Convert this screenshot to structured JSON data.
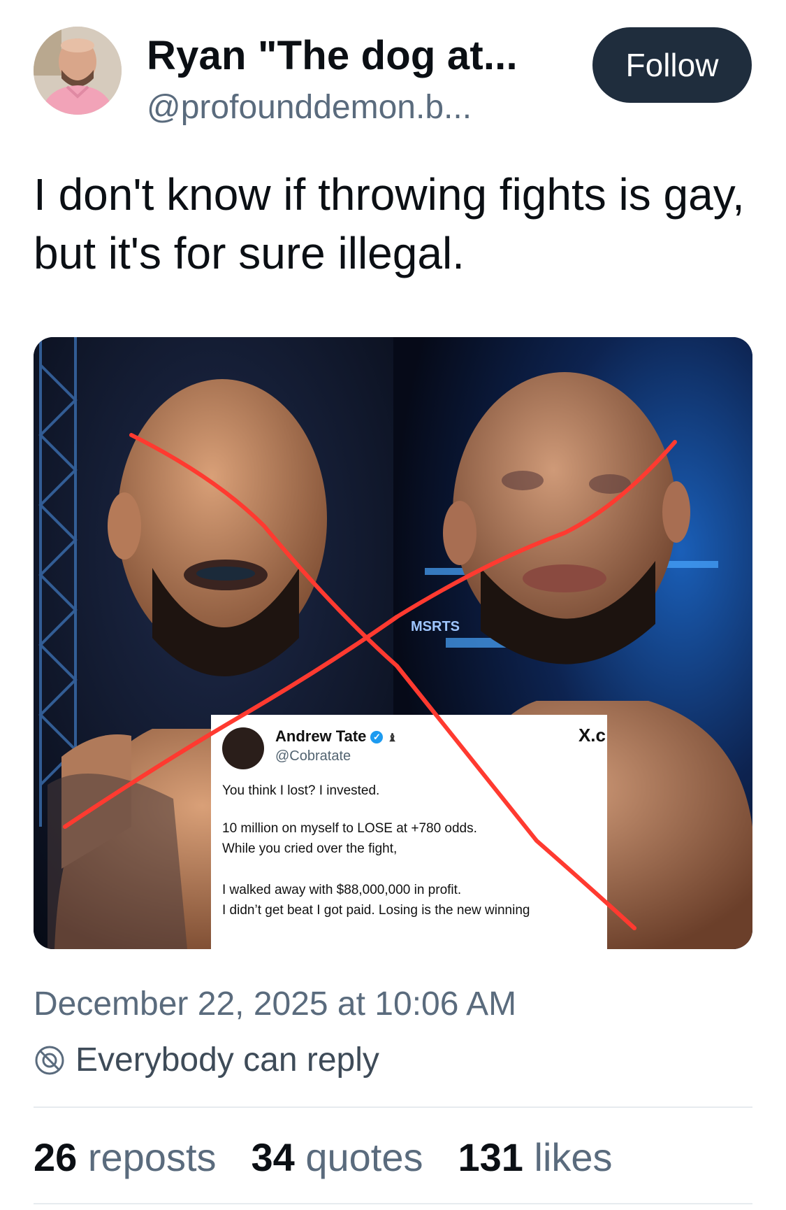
{
  "post": {
    "author_name": "Ryan \"The dog at...",
    "author_handle": "@profounddemon.b...",
    "follow_label": "Follow",
    "text": "I don't know if throwing fights is gay, but it's for sure illegal.",
    "timestamp": "December 22, 2025 at 10:06 AM",
    "reply_setting": "Everybody can reply"
  },
  "embedded_image": {
    "arena_banner": "MSRTS",
    "quote_card": {
      "name": "Andrew Tate",
      "handle": "@Cobratate",
      "source_mark": "X.c",
      "lines": [
        "You think I lost? I invested.",
        "10 million on myself to LOSE at +780 odds.",
        "While you cried over the fight,",
        "I walked away with $88,000,000 in profit.",
        "I didn’t get beat I got paid. Losing is the new winning"
      ]
    },
    "cross_color": "#ff3a30"
  },
  "stats": {
    "reposts_count": "26",
    "reposts_label": "reposts",
    "quotes_count": "34",
    "quotes_label": "quotes",
    "likes_count": "131",
    "likes_label": "likes"
  },
  "colors": {
    "follow_bg": "#1f2d3d",
    "secondary_text": "#5a6b7d",
    "divider": "#e6ebef"
  }
}
